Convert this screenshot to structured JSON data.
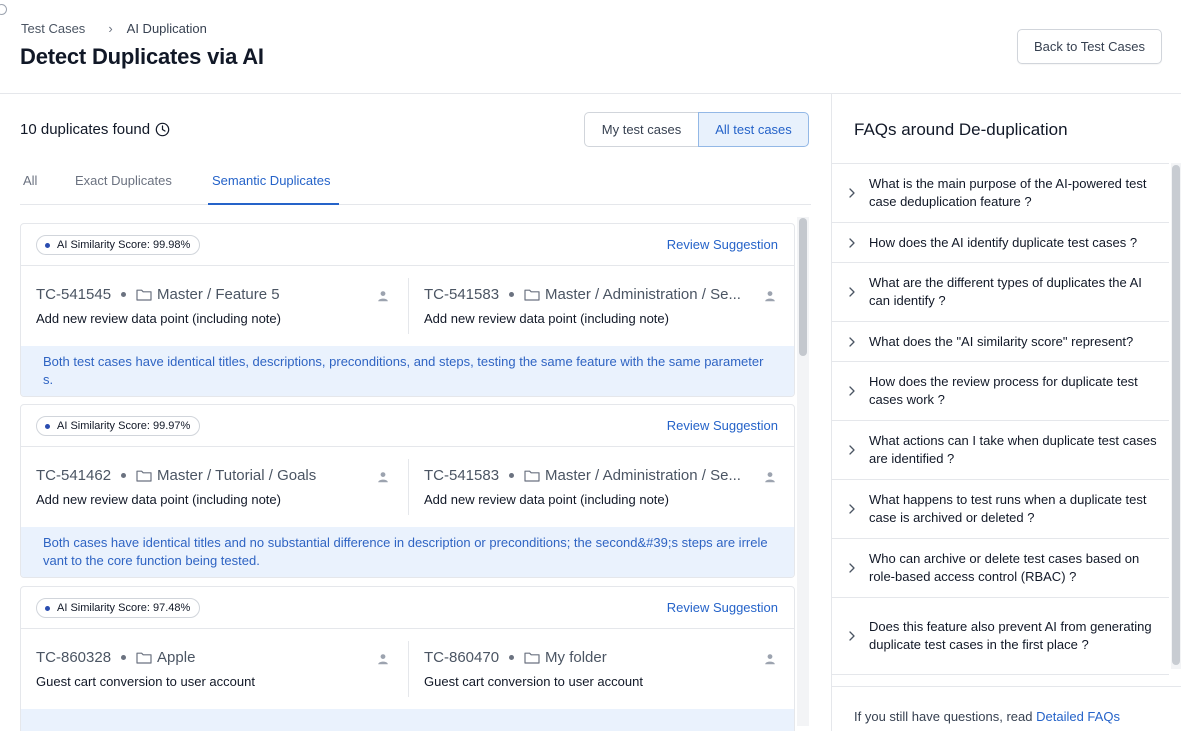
{
  "breadcrumb": {
    "parent": "Test Cases",
    "separator": "›",
    "current": "AI Duplication"
  },
  "page_title": "Detect Duplicates via AI",
  "back_button": "Back to Test Cases",
  "summary": {
    "count_text": "10 duplicates found"
  },
  "scope_toggle": {
    "options": [
      "My test cases",
      "All test cases"
    ],
    "selected": "All test cases"
  },
  "tabs": [
    {
      "label": "All"
    },
    {
      "label": "Exact Duplicates"
    },
    {
      "label": "Semantic Duplicates"
    }
  ],
  "active_tab": "Semantic Duplicates",
  "review_label": "Review Suggestion",
  "cards": [
    {
      "score": "AI Similarity Score: 99.98%",
      "left": {
        "id": "TC-541545",
        "path": "Master / Feature 5",
        "title": "Add new review data point (including note)"
      },
      "right": {
        "id": "TC-541583",
        "path": "Master / Administration / Se...",
        "title": "Add new review data point (including note)"
      },
      "note": "Both test cases have identical titles, descriptions, preconditions, and steps, testing the same feature with the same parameters."
    },
    {
      "score": "AI Similarity Score: 99.97%",
      "left": {
        "id": "TC-541462",
        "path": "Master / Tutorial / Goals",
        "title": "Add new review data point (including note)"
      },
      "right": {
        "id": "TC-541583",
        "path": "Master / Administration / Se...",
        "title": "Add new review data point (including note)"
      },
      "note": "Both cases have identical titles and no substantial difference in description or preconditions; the second&#39;s steps are irrelevant to the core function being tested."
    },
    {
      "score": "AI Similarity Score: 97.48%",
      "left": {
        "id": "TC-860328",
        "path": "Apple",
        "title": "Guest cart conversion to user account"
      },
      "right": {
        "id": "TC-860470",
        "path": "My folder",
        "title": "Guest cart conversion to user account"
      },
      "note": ""
    }
  ],
  "faq": {
    "title": "FAQs around De-duplication",
    "items": [
      "What is the main purpose of the AI-powered test case deduplication feature ?",
      "How does the AI identify duplicate test cases ?",
      "What are the different types of duplicates the AI can identify ?",
      "What does the \"AI similarity score\" represent?",
      "How does the review process for duplicate test cases work ?",
      "What actions can I take when duplicate test cases are identified ?",
      "What happens to test runs when a duplicate test case is archived or deleted ?",
      "Who can archive or delete test cases based on role-based access control (RBAC) ?",
      "Does this feature also prevent AI from generating duplicate test cases in the first place ?"
    ],
    "footer_text": "If you still have questions, read",
    "footer_link": "Detailed FAQs"
  },
  "icons": {
    "history": "clock-icon",
    "folder": "folder-icon",
    "owner": "user-icon",
    "expand": "chevron-right-icon"
  },
  "colors": {
    "accent": "#2563c9",
    "note_bg": "#eaf2fd",
    "score_dot": "#2a4db0"
  }
}
